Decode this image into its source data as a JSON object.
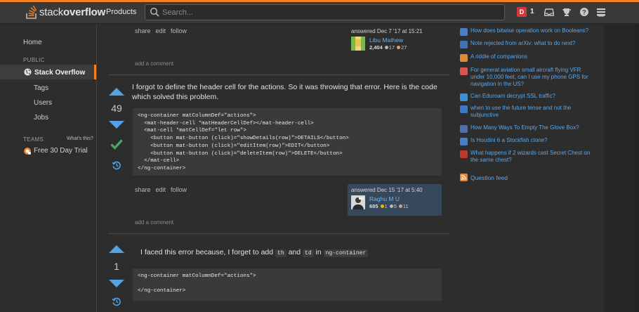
{
  "header": {
    "logo_text_plain": "stack",
    "logo_text_bold": "overflow",
    "nav_products": "Products",
    "search_placeholder": "Search...",
    "avatar_letter": "D",
    "reputation": "1"
  },
  "leftnav": {
    "home": "Home",
    "public_heading": "PUBLIC",
    "stack_overflow": "Stack Overflow",
    "tags": "Tags",
    "users": "Users",
    "jobs": "Jobs",
    "teams_heading": "TEAMS",
    "whats_this": "What's this?",
    "free_trial": "Free 30 Day Trial"
  },
  "post_top": {
    "actions": [
      "share",
      "edit",
      "follow"
    ],
    "answered": "answered Dec 7 '17 at 15:21",
    "user_name": "Libu Mathew",
    "rep": "2,404",
    "silver": "17",
    "bronze": "27",
    "add_comment": "add a comment"
  },
  "answer1": {
    "votes": "49",
    "text_line1": "I forgot to define the header cell for the actions. So it was throwing that error. Here is the code",
    "text_line2": "which solved this problem.",
    "code": "<ng-container matColumnDef=\"actions\">\n  <mat-header-cell *matHeaderCellDef></mat-header-cell>\n  <mat-cell *matCellDef=\"let row\">\n    <button mat-button (click)=\"showDetails(row)\">DETAILS</button>\n    <button mat-button (click)=\"editItem(row)\">EDIT</button>\n    <button mat-button (click)=\"deleteItem(row)\">DELETE</button>\n  </mat-cell>\n</ng-container>",
    "actions": [
      "share",
      "edit",
      "follow"
    ],
    "answered": "answered Dec 15 '17 at 5:40",
    "user_name": "Raghu M U",
    "rep": "685",
    "gold": "1",
    "silver": "5",
    "bronze": "11",
    "add_comment": "add a comment"
  },
  "answer2": {
    "votes": "1",
    "text_before": "I faced this error because, I forget to add",
    "code_th": "th",
    "text_and": "and",
    "code_td": "td",
    "text_in": "in",
    "code_ng": "ng-container",
    "code": "<ng-container matColumnDef=\"actions\">\n\n</ng-container>"
  },
  "hot_network_questions": [
    {
      "title": "How does bitwise operation work on Booleans?",
      "icon": "math-icon",
      "color": "#4a7fc1"
    },
    {
      "title": "Note rejected from arXiv: what to do next?",
      "icon": "academia-icon",
      "color": "#3f73b6"
    },
    {
      "title": "A riddle of companions",
      "icon": "puzzling-icon",
      "color": "#e28a3a"
    },
    {
      "title": "For general aviation small aircraft flying VFR under 10,000 feet, can I use my phone GPS for navigation in the US?",
      "icon": "aviation-icon",
      "color": "#d9534f"
    },
    {
      "title": "Can Eduroam decrypt SSL traffic?",
      "icon": "security-icon",
      "color": "#3b8fd4"
    },
    {
      "title": "when to use the future tense and not the subjunctive",
      "icon": "language-icon",
      "color": "#3d79c9"
    },
    {
      "title": "How Many Ways To Empty The Glove Box?",
      "icon": "code-golf-icon",
      "color": "#4e6fb0"
    },
    {
      "title": "Is Houdini 6 a Stockfish clone?",
      "icon": "chess-icon",
      "color": "#4a7fc1"
    },
    {
      "title": "What happens if 2 wizards cast Secret Chest on the same chest?",
      "icon": "rpg-icon",
      "color": "#c0392b"
    }
  ],
  "question_feed": "Question feed"
}
